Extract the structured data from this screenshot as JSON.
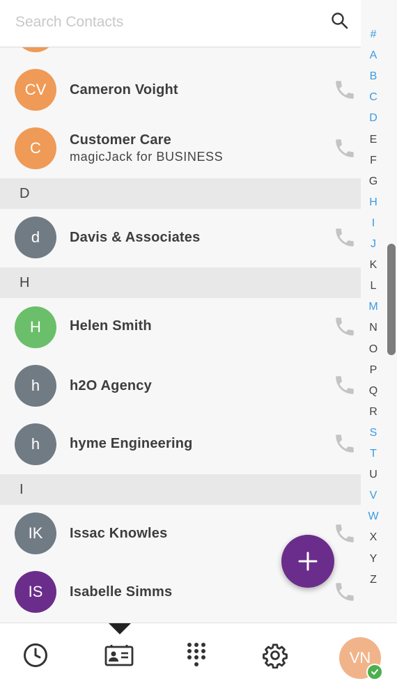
{
  "search": {
    "placeholder": "Search Contacts",
    "icon": "search-icon"
  },
  "colors": {
    "accent_blue": "#3b9be0",
    "fab": "#6b2d8b",
    "avatar_orange": "#ef9a56",
    "avatar_gray": "#707b84",
    "avatar_green": "#6bbf6b",
    "avatar_purple": "#6b2d8b",
    "online": "#4caf50"
  },
  "contacts": [
    {
      "initials": "CV",
      "name": "Cameron Voight",
      "subtitle": "",
      "avatar_color": "#ef9a56"
    },
    {
      "initials": "C",
      "name": "Customer Care",
      "subtitle": "magicJack for BUSINESS",
      "avatar_color": "#ef9a56"
    },
    {
      "initials": "d",
      "name": "Davis & Associates",
      "subtitle": "",
      "avatar_color": "#707b84"
    },
    {
      "initials": "H",
      "name": "Helen Smith",
      "subtitle": "",
      "avatar_color": "#6bbf6b"
    },
    {
      "initials": "h",
      "name": "h2O Agency",
      "subtitle": "",
      "avatar_color": "#707b84"
    },
    {
      "initials": "h",
      "name": "hyme Engineering",
      "subtitle": "",
      "avatar_color": "#707b84"
    },
    {
      "initials": "IK",
      "name": "Issac Knowles",
      "subtitle": "",
      "avatar_color": "#707b84"
    },
    {
      "initials": "IS",
      "name": "Isabelle Simms",
      "subtitle": "",
      "avatar_color": "#6b2d8b"
    }
  ],
  "sections": [
    "D",
    "H",
    "I"
  ],
  "alphabet": [
    {
      "letter": "#",
      "active": true
    },
    {
      "letter": "A",
      "active": true
    },
    {
      "letter": "B",
      "active": true
    },
    {
      "letter": "C",
      "active": true
    },
    {
      "letter": "D",
      "active": true
    },
    {
      "letter": "E",
      "active": false
    },
    {
      "letter": "F",
      "active": false
    },
    {
      "letter": "G",
      "active": false
    },
    {
      "letter": "H",
      "active": true
    },
    {
      "letter": "I",
      "active": true
    },
    {
      "letter": "J",
      "active": true
    },
    {
      "letter": "K",
      "active": false
    },
    {
      "letter": "L",
      "active": false
    },
    {
      "letter": "M",
      "active": true
    },
    {
      "letter": "N",
      "active": false
    },
    {
      "letter": "O",
      "active": false
    },
    {
      "letter": "P",
      "active": false
    },
    {
      "letter": "Q",
      "active": false
    },
    {
      "letter": "R",
      "active": false
    },
    {
      "letter": "S",
      "active": true
    },
    {
      "letter": "T",
      "active": true
    },
    {
      "letter": "U",
      "active": false
    },
    {
      "letter": "V",
      "active": true
    },
    {
      "letter": "W",
      "active": true
    },
    {
      "letter": "X",
      "active": false
    },
    {
      "letter": "Y",
      "active": false
    },
    {
      "letter": "Z",
      "active": false
    }
  ],
  "fab": {
    "icon": "plus-icon"
  },
  "nav": {
    "items": [
      "clock-icon",
      "contacts-card-icon",
      "dialpad-icon",
      "gear-icon"
    ],
    "selected": "contacts-card-icon",
    "profile_initials": "VN",
    "profile_status": "online"
  }
}
